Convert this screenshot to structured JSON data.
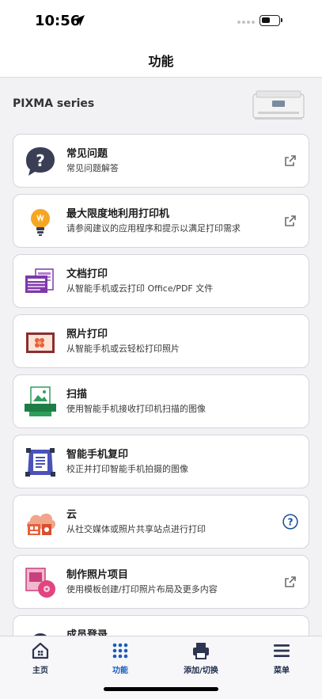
{
  "status": {
    "time": "10:56"
  },
  "nav": {
    "title": "功能"
  },
  "printer": {
    "series": "PIXMA series"
  },
  "items": [
    {
      "title": "常见问题",
      "subtitle": "常见问题解答",
      "icon": "faq-icon",
      "trailing": "external-link-icon"
    },
    {
      "title": "最大限度地利用打印机",
      "subtitle": "请参阅建议的应用程序和提示以满足打印需求",
      "icon": "lightbulb-icon",
      "trailing": "external-link-icon"
    },
    {
      "title": "文档打印",
      "subtitle": "从智能手机或云打印 Office/PDF 文件",
      "icon": "document-print-icon",
      "trailing": ""
    },
    {
      "title": "照片打印",
      "subtitle": "从智能手机或云轻松打印照片",
      "icon": "photo-print-icon",
      "trailing": ""
    },
    {
      "title": "扫描",
      "subtitle": "使用智能手机接收打印机扫描的图像",
      "icon": "scan-icon",
      "trailing": ""
    },
    {
      "title": "智能手机复印",
      "subtitle": "校正并打印智能手机拍摄的图像",
      "icon": "smartphone-copy-icon",
      "trailing": ""
    },
    {
      "title": "云",
      "subtitle": "从社交媒体或照片共享站点进行打印",
      "icon": "cloud-icon",
      "trailing": "help-icon"
    },
    {
      "title": "制作照片项目",
      "subtitle": "使用模板创建/打印照片布局及更多内容",
      "icon": "photo-project-icon",
      "trailing": "external-link-icon"
    },
    {
      "title": "成员登录",
      "subtitle": "",
      "icon": "member-icon",
      "trailing": "external-link-icon"
    }
  ],
  "tabs": [
    {
      "label": "主页",
      "icon": "home-icon"
    },
    {
      "label": "功能",
      "icon": "grid-icon"
    },
    {
      "label": "添加/切换",
      "icon": "printer-icon"
    },
    {
      "label": "菜单",
      "icon": "menu-icon"
    }
  ],
  "colors": {
    "accent": "#1a5bbf",
    "dark_navy": "#2d3550",
    "purple": "#7d3aa8",
    "orange": "#e86a3a"
  }
}
